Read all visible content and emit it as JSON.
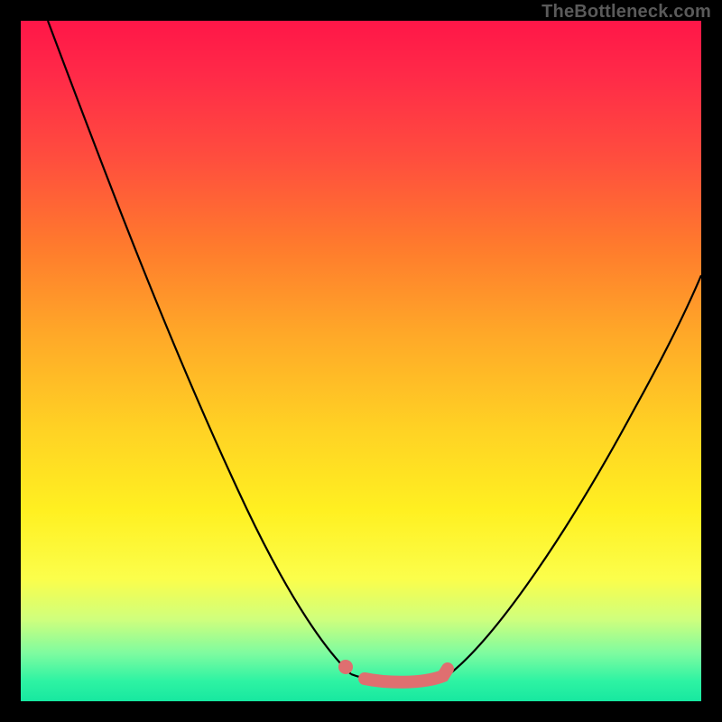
{
  "watermark": "TheBottleneck.com",
  "chart_data": {
    "type": "line",
    "title": "",
    "xlabel": "",
    "ylabel": "",
    "xlim": [
      0,
      100
    ],
    "ylim": [
      0,
      100
    ],
    "series": [
      {
        "name": "left-curve",
        "x": [
          4,
          7,
          10,
          13,
          16,
          19,
          22,
          25,
          28,
          31,
          34,
          37,
          40,
          43,
          46,
          48.5
        ],
        "values": [
          100,
          92,
          84,
          76.5,
          69,
          62,
          55,
          48,
          41.5,
          35,
          29,
          23,
          17.5,
          12,
          7,
          4
        ]
      },
      {
        "name": "flat-segment",
        "x": [
          48.5,
          52,
          56,
          60,
          63
        ],
        "values": [
          4,
          3.3,
          3.2,
          3.4,
          4
        ]
      },
      {
        "name": "right-curve",
        "x": [
          63,
          66,
          70,
          74,
          78,
          82,
          86,
          90,
          94,
          98,
          100
        ],
        "values": [
          4,
          7,
          12,
          17.5,
          23.5,
          30,
          37,
          44,
          51.5,
          59,
          63
        ]
      }
    ],
    "annotations": [
      {
        "name": "highlight-dot",
        "x": 47.8,
        "y": 5.2
      },
      {
        "name": "highlight-segment",
        "x": [
          50.5,
          62.5
        ],
        "y": [
          3.3,
          3.8
        ]
      }
    ],
    "background_gradient": [
      "#ff1648",
      "#ff4d3e",
      "#ffa828",
      "#fff021",
      "#cfff7d",
      "#17e8a0"
    ]
  }
}
